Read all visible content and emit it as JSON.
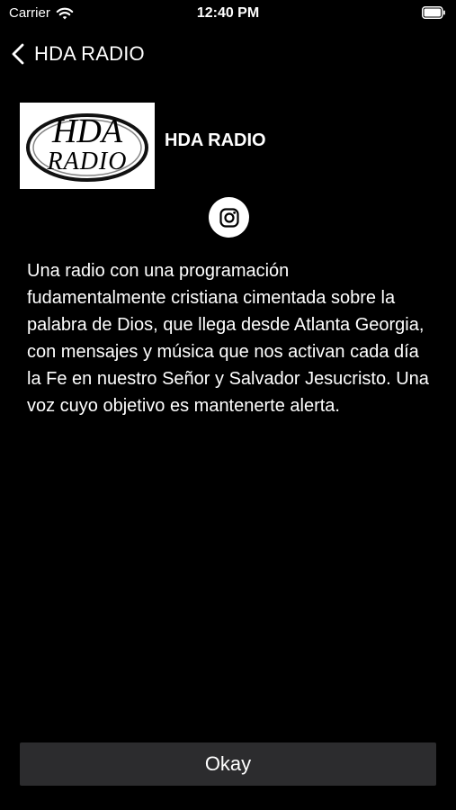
{
  "status_bar": {
    "carrier": "Carrier",
    "time": "12:40 PM"
  },
  "nav": {
    "back_icon": "chevron-left-icon",
    "title": "HDA RADIO"
  },
  "station": {
    "logo_text_top": "HDA",
    "logo_text_bottom": "RADIO",
    "name": "HDA RADIO"
  },
  "social": {
    "icon": "instagram-icon"
  },
  "description": "Una radio  con una programación fudamentalmente cristiana cimentada sobre la palabra de Dios, que llega desde Atlanta Georgia, con mensajes y música que nos activan cada día la Fe en nuestro Señor y Salvador Jesucristo. Una voz cuyo objetivo es mantenerte alerta.",
  "actions": {
    "okay_label": "Okay"
  },
  "colors": {
    "background": "#000000",
    "text": "#ffffff",
    "button_bg": "#2c2c2e"
  }
}
